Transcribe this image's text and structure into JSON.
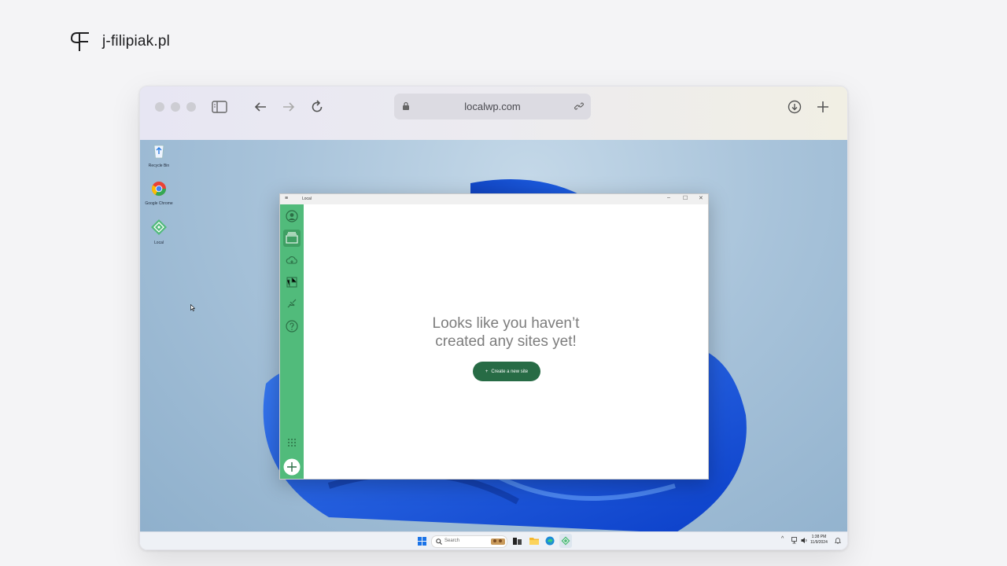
{
  "brand": {
    "name": "j-filipiak.pl"
  },
  "browser": {
    "url": "localwp.com",
    "icons": [
      "sidebar-icon",
      "back-icon",
      "forward-icon",
      "reload-icon",
      "lock-icon",
      "link-icon",
      "download-icon",
      "new-tab-icon"
    ]
  },
  "desktop": {
    "icons": [
      {
        "label": "Recycle Bin",
        "icon": "recycle-bin-icon"
      },
      {
        "label": "Google Chrome",
        "icon": "chrome-icon"
      },
      {
        "label": "Local",
        "icon": "local-icon"
      }
    ]
  },
  "app": {
    "title": "Local",
    "sidebar": [
      "account-icon",
      "sites-icon",
      "cloud-backups-icon",
      "blueprints-icon",
      "addons-icon",
      "help-icon",
      "apps-grid-icon",
      "add-site-icon"
    ],
    "empty_message": "Looks like you haven’t\ncreated any sites yet!",
    "create_button": "Create a new site",
    "colors": {
      "sidebar": "#51bb7b",
      "sidebar_active": "#3f9f63",
      "button": "#276b45"
    }
  },
  "taskbar": {
    "search_placeholder": "Search",
    "time": "1:38 PM",
    "date": "11/9/2024"
  }
}
